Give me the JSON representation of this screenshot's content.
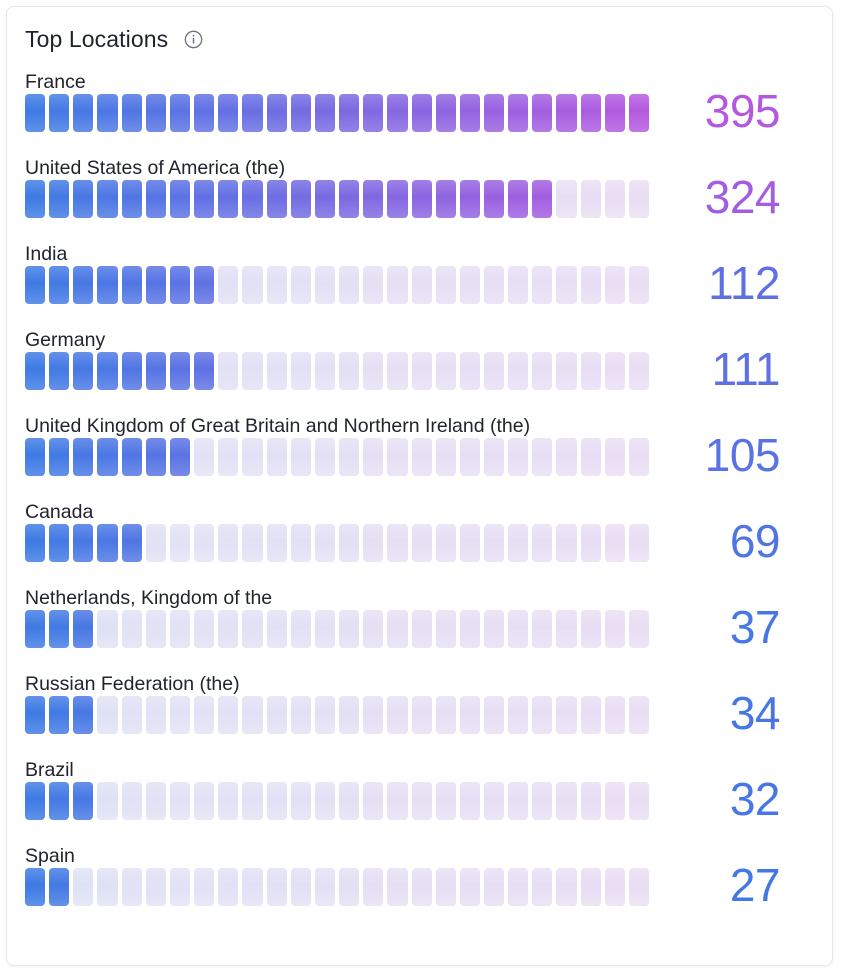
{
  "card": {
    "title": "Top Locations",
    "info_icon": "info-circle-icon"
  },
  "theme": {
    "gradient_start": "#3d7ae4",
    "gradient_end": "#b558e0",
    "track_start": "#dde2f5",
    "track_end": "#e9ddf4",
    "title_color": "#1e222b",
    "label_color": "#20242c",
    "card_border": "#e6e8ec",
    "card_background": "#ffffff"
  },
  "chart_data": {
    "type": "bar",
    "title": "Top Locations",
    "xlabel": "",
    "ylabel": "",
    "segments_total": 26,
    "max_value": 395,
    "categories": [
      "France",
      "United States of America (the)",
      "India",
      "Germany",
      "United Kingdom of Great Britain and Northern Ireland (the)",
      "Canada",
      "Netherlands, Kingdom of the",
      "Russian Federation (the)",
      "Brazil",
      "Spain"
    ],
    "values": [
      395,
      324,
      112,
      111,
      105,
      69,
      37,
      34,
      32,
      27
    ],
    "value_labels": [
      "395",
      "324",
      "112",
      "111",
      "105",
      "69",
      "37",
      "34",
      "32",
      "27"
    ],
    "filled_segments": [
      26,
      22,
      8,
      8,
      7,
      5,
      3,
      3,
      3,
      2
    ]
  }
}
